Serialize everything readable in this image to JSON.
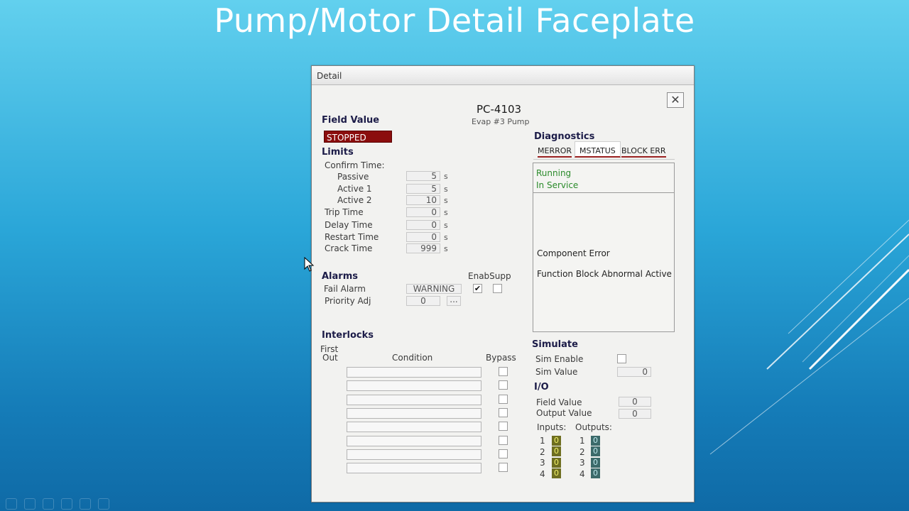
{
  "slide": {
    "title": "Pump/Motor Detail Faceplate"
  },
  "window": {
    "title": "Detail",
    "close_icon": "close-icon"
  },
  "header": {
    "tag": "PC-4103",
    "description": "Evap #3 Pump"
  },
  "field_value": {
    "heading": "Field Value",
    "status": "STOPPED",
    "status_color": "#8b0d0d"
  },
  "limits": {
    "heading": "Limits",
    "confirm_time": "Confirm Time:",
    "passive_label": "Passive",
    "passive": "5",
    "active1_label": "Active 1",
    "active1": "5",
    "active2_label": "Active 2",
    "active2": "10",
    "trip_label": "Trip Time",
    "trip": "0",
    "delay_label": "Delay Time",
    "delay": "0",
    "restart_label": "Restart Time",
    "restart": "0",
    "crack_label": "Crack Time",
    "crack": "999",
    "unit": "s"
  },
  "alarms": {
    "heading": "Alarms",
    "enab_supp": "EnabSupp",
    "fail_label": "Fail Alarm",
    "fail_value": "WARNING",
    "fail_enabled": "✔",
    "priority_label": "Priority Adj",
    "priority_value": "0",
    "more_button": "..."
  },
  "interlocks": {
    "heading": "Interlocks",
    "first_out_line1": "First",
    "first_out_line2": "Out",
    "condition": "Condition",
    "bypass": "Bypass"
  },
  "diagnostics": {
    "heading": "Diagnostics",
    "tabs": [
      "MERROR",
      "MSTATUS",
      "BLOCK ERR"
    ],
    "status1": "Running",
    "status2": "In Service",
    "err1": "Component Error",
    "err2": "Function Block Abnormal Active"
  },
  "simulate": {
    "heading": "Simulate",
    "enable_label": "Sim Enable",
    "value_label": "Sim Value",
    "value": "0"
  },
  "io": {
    "heading": "I/O",
    "field_label": "Field Value",
    "field_value": "0",
    "output_label": "Output Value",
    "output_value": "0",
    "inputs_label": "Inputs:",
    "outputs_label": "Outputs:",
    "inputs": [
      {
        "n": "1",
        "v": "0"
      },
      {
        "n": "2",
        "v": "0"
      },
      {
        "n": "3",
        "v": "0"
      },
      {
        "n": "4",
        "v": "0"
      }
    ],
    "outputs": [
      {
        "n": "1",
        "v": "0"
      },
      {
        "n": "2",
        "v": "0"
      },
      {
        "n": "3",
        "v": "0"
      },
      {
        "n": "4",
        "v": "0"
      }
    ]
  }
}
